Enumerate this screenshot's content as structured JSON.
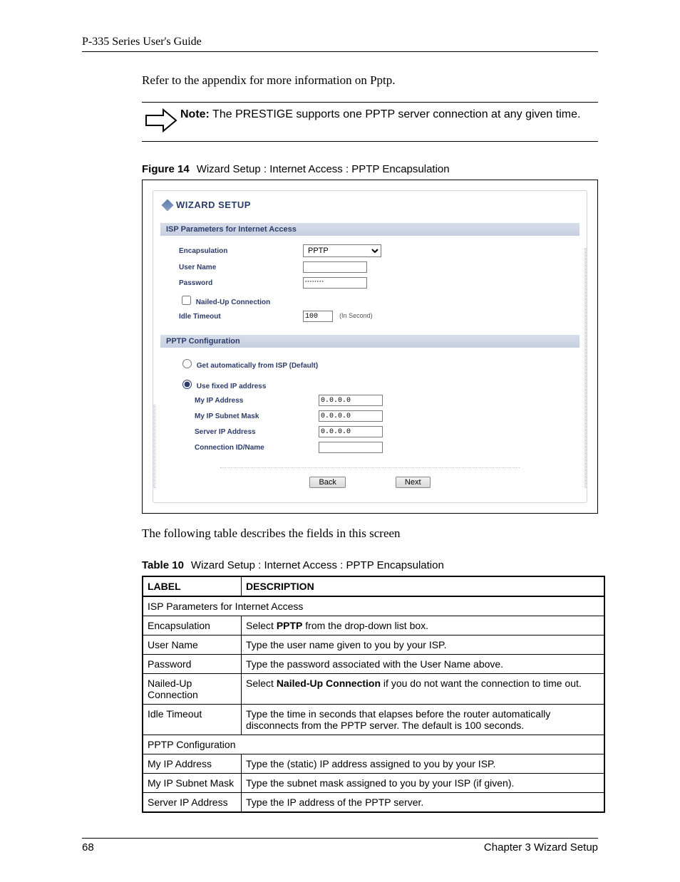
{
  "running_head": "P-335 Series User's Guide",
  "intro": "Refer to the appendix for more information on Pptp.",
  "note": {
    "label": "Note:",
    "text": " The PRESTIGE supports one PPTP server connection at any given time."
  },
  "figure": {
    "label": "Figure 14",
    "title": "Wizard Setup : Internet Access : PPTP Encapsulation"
  },
  "wizard": {
    "title": "WIZARD SETUP",
    "section1": "ISP Parameters for Internet Access",
    "encapsulation_label": "Encapsulation",
    "encapsulation_value": "PPTP",
    "username_label": "User Name",
    "username_value": "",
    "password_label": "Password",
    "password_value": "********",
    "nailed_label": "Nailed-Up Connection",
    "idle_label": "Idle Timeout",
    "idle_value": "100",
    "idle_unit": "(In Second)",
    "section2": "PPTP Configuration",
    "radio1": "Get automatically from ISP (Default)",
    "radio2": "Use fixed IP address",
    "myip_label": "My IP Address",
    "myip_value": "0.0.0.0",
    "mysubnet_label": "My IP Subnet Mask",
    "mysubnet_value": "0.0.0.0",
    "serverip_label": "Server IP Address",
    "serverip_value": "0.0.0.0",
    "conn_label": "Connection ID/Name",
    "conn_value": "",
    "back": "Back",
    "next": "Next"
  },
  "after_figure": "The following table describes the fields in this screen",
  "table_caption": {
    "label": "Table 10",
    "title": "Wizard Setup : Internet Access : PPTP Encapsulation"
  },
  "table": {
    "head_label": "LABEL",
    "head_desc": "DESCRIPTION",
    "rows": [
      {
        "span": true,
        "label": "ISP Parameters for Internet Access"
      },
      {
        "label": "Encapsulation",
        "desc_pre": "Select ",
        "desc_bold": "PPTP",
        "desc_post": " from the drop-down list box."
      },
      {
        "label": "User Name",
        "desc": "Type the user name given to you by your ISP."
      },
      {
        "label": "Password",
        "desc": "Type the password associated with the User Name above."
      },
      {
        "label": "Nailed-Up Connection",
        "desc_pre": "Select ",
        "desc_bold": "Nailed-Up Connection",
        "desc_post": " if you do not want the connection to time out."
      },
      {
        "label": "Idle Timeout",
        "desc": "Type the time in seconds that elapses before the router automatically disconnects from the PPTP server. The default is 100 seconds."
      },
      {
        "span": true,
        "label": "PPTP Configuration"
      },
      {
        "label": "My IP Address",
        "desc": "Type the (static) IP address assigned to you by your ISP."
      },
      {
        "label": "My IP Subnet Mask",
        "desc": "Type the subnet mask assigned to you by your ISP (if given)."
      },
      {
        "label": "Server IP Address",
        "desc": "Type the IP address of the PPTP server."
      }
    ]
  },
  "footer": {
    "page": "68",
    "chapter": "Chapter 3 Wizard Setup"
  }
}
